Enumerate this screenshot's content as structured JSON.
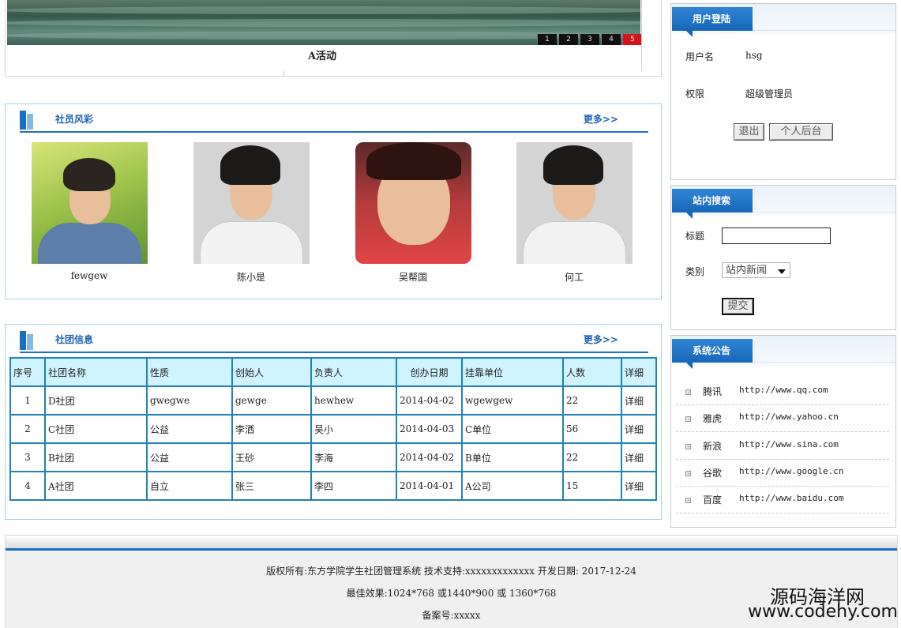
{
  "banner": {
    "caption": "A活动",
    "nav": [
      "1",
      "2",
      "3",
      "4",
      "5"
    ],
    "active_index": 4
  },
  "members": {
    "title": "社员风彩",
    "more": "更多>>",
    "items": [
      {
        "name": "fewgew"
      },
      {
        "name": "陈小是"
      },
      {
        "name": "吴帮国"
      },
      {
        "name": "何工"
      }
    ]
  },
  "clubs": {
    "title": "社团信息",
    "more": "更多>>",
    "columns": [
      "序号",
      "社团名称",
      "性质",
      "创始人",
      "负责人",
      "创办日期",
      "挂靠单位",
      "人数",
      "详细"
    ],
    "rows": [
      [
        "1",
        "D社团",
        "gwegwe",
        "gewge",
        "hewhew",
        "2014-04-02",
        "wgewgew",
        "22",
        "详细"
      ],
      [
        "2",
        "C社团",
        "公益",
        "李洒",
        "吴小",
        "2014-04-03",
        "C单位",
        "56",
        "详细"
      ],
      [
        "3",
        "B社团",
        "公益",
        "王砂",
        "李海",
        "2014-04-02",
        "B单位",
        "22",
        "详细"
      ],
      [
        "4",
        "A社团",
        "自立",
        "张三",
        "李四",
        "2014-04-01",
        "A公司",
        "15",
        "详细"
      ]
    ]
  },
  "login": {
    "title": "用户登陆",
    "username_label": "用户名",
    "username_value": "hsg",
    "role_label": "权限",
    "role_value": "超级管理员",
    "logout_label": "退出",
    "backend_label": "个人后台"
  },
  "search": {
    "title": "站内搜索",
    "title_label": "标题",
    "title_value": "",
    "category_label": "类别",
    "category_value": "站内新闻",
    "submit_label": "提交"
  },
  "notice": {
    "title": "系统公告",
    "items": [
      {
        "name": "腾讯",
        "url": "http://www.qq.com"
      },
      {
        "name": "雅虎",
        "url": "http://www.yahoo.cn"
      },
      {
        "name": "新浪",
        "url": "http://www.sina.com"
      },
      {
        "name": "谷歌",
        "url": "http://www.google.cn"
      },
      {
        "name": "百度",
        "url": "http://www.baidu.com"
      }
    ]
  },
  "footer": {
    "line1": "版权所有:东方学院学生社团管理系统 技术支持:xxxxxxxxxxxxx 开发日期: 2017-12-24",
    "line2": "最佳效果:1024*768 或1440*900 或 1360*768",
    "line3": "备案号:xxxxx"
  },
  "watermark": {
    "cn": "源码海洋网",
    "en": "www.codehy.com"
  },
  "colors": {
    "accent_blue": "#1b6fc2",
    "panel_border": "#a6d2ec",
    "table_header_bg": "#cff3ff",
    "table_border": "#1f82b8",
    "banner_active": "#d6121a"
  }
}
